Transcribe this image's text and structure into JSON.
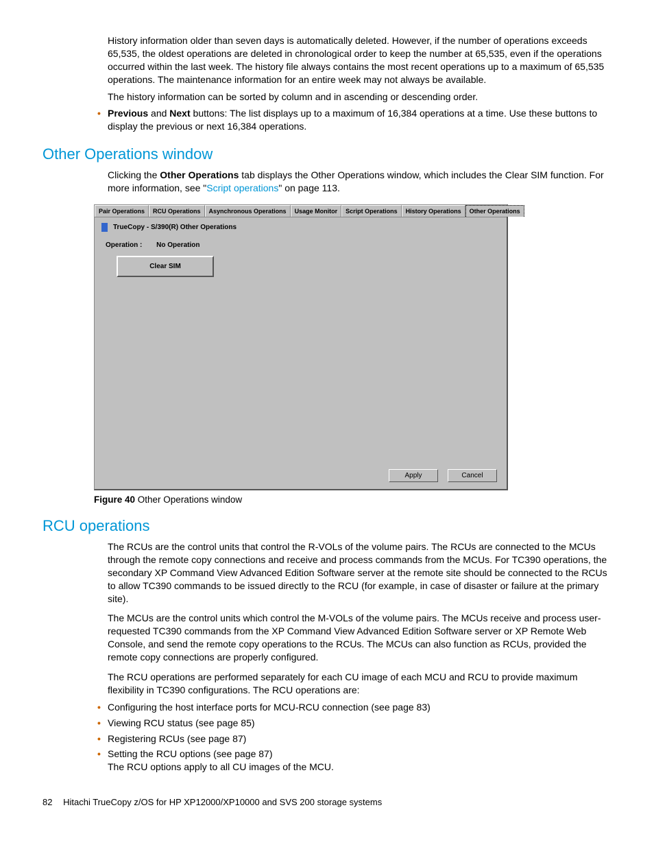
{
  "top": {
    "p1": "History information older than seven days is automatically deleted. However, if the number of operations exceeds 65,535, the oldest operations are deleted in chronological order to keep the number at 65,535, even if the operations occurred within the last week. The history file always contains the most recent operations up to a maximum of 65,535 operations. The maintenance information for an entire week may not always be available.",
    "p2": "The history information can be sorted by column and in ascending or descending order.",
    "bullet_bold1": "Previous",
    "bullet_mid": " and ",
    "bullet_bold2": "Next",
    "bullet_rest": " buttons: The list displays up to a maximum of 16,384 operations at a time. Use these buttons to display the previous or next 16,384 operations."
  },
  "sec1": {
    "heading": "Other Operations window",
    "p_pre": "Clicking the ",
    "p_bold": "Other Operations",
    "p_mid": " tab displays the Other Operations window, which includes the Clear SIM function. For more information, see \"",
    "p_link": "Script operations",
    "p_post": "\" on page 113."
  },
  "win": {
    "tabs": [
      "Pair Operations",
      "RCU Operations",
      "Asynchronous Operations",
      "Usage Monitor",
      "Script Operations",
      "History Operations",
      "Other Operations"
    ],
    "title": "TrueCopy - S/390(R) Other Operations",
    "op_label": "Operation :",
    "op_value": "No Operation",
    "clear_sim": "Clear SIM",
    "apply": "Apply",
    "cancel": "Cancel"
  },
  "fig": {
    "bold": "Figure 40",
    "rest": " Other Operations window"
  },
  "sec2": {
    "heading": "RCU operations",
    "p1": "The RCUs are the control units that control the R-VOLs of the volume pairs. The RCUs are connected to the MCUs through the remote copy connections and receive and process commands from the MCUs. For TC390 operations, the secondary XP Command View Advanced Edition Software server at the remote site should be connected to the RCUs to allow TC390 commands to be issued directly to the RCU (for example, in case of disaster or failure at the primary site).",
    "p2": "The MCUs are the control units which control the M-VOLs of the volume pairs. The MCUs receive and process user-requested TC390 commands from the XP Command View Advanced Edition Software server or XP Remote Web Console, and send the remote copy operations to the RCUs. The MCUs can also function as RCUs, provided the remote copy connections are properly configured.",
    "p3": "The RCU operations are performed separately for each CU image of each MCU and RCU to provide maximum flexibility in TC390 configurations. The RCU operations are:",
    "bullets": [
      "Configuring the host interface ports for MCU-RCU connection (see page 83)",
      "Viewing RCU status (see page 85)",
      "Registering RCUs (see page 87)",
      "Setting the RCU options (see page 87)\nThe RCU options apply to all CU images of the MCU."
    ]
  },
  "footer": {
    "page": "82",
    "title": "Hitachi TrueCopy z/OS for HP XP12000/XP10000 and SVS 200 storage systems"
  }
}
